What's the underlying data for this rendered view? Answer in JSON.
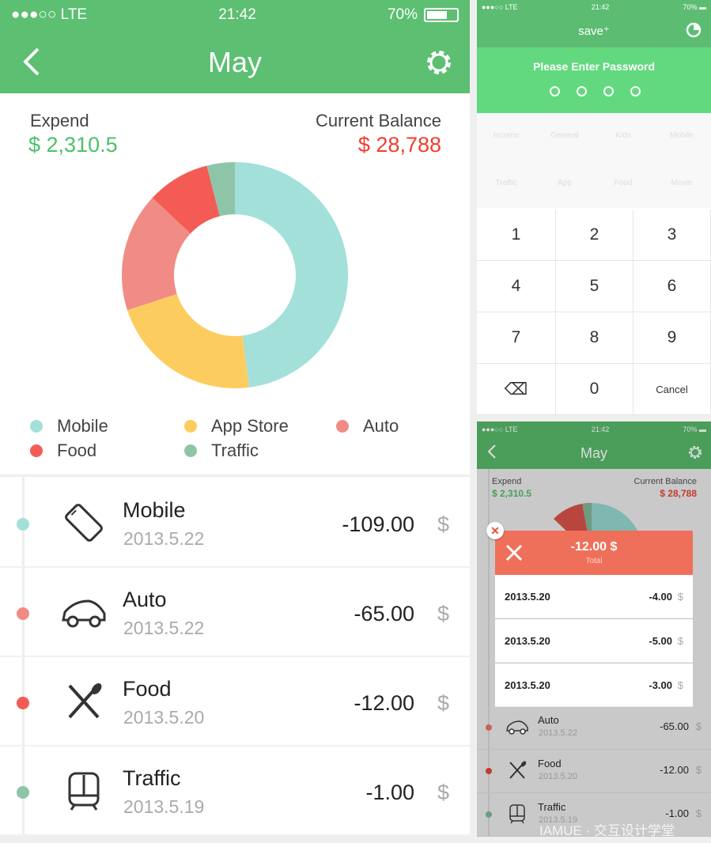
{
  "status": {
    "signal": "●●●○○",
    "carrier": "LTE",
    "time": "21:42",
    "battery": "70%"
  },
  "main": {
    "title": "May",
    "expend_label": "Expend",
    "expend_value": "$ 2,310.5",
    "balance_label": "Current Balance",
    "balance_value": "$ 28,788",
    "colors": {
      "header": "#5cbf72",
      "expend": "#4cc06a",
      "balance": "#f23d2e"
    },
    "donut": [
      {
        "name": "Mobile",
        "fraction": 0.48,
        "color": "#a3e0da"
      },
      {
        "name": "App Store",
        "fraction": 0.22,
        "color": "#fccd5e"
      },
      {
        "name": "Auto",
        "fraction": 0.17,
        "color": "#f08c85"
      },
      {
        "name": "Food",
        "fraction": 0.09,
        "color": "#f45b55"
      },
      {
        "name": "Traffic",
        "fraction": 0.04,
        "color": "#8ec5a8"
      }
    ],
    "legend": [
      "Mobile",
      "App Store",
      "Auto",
      "Food",
      "Traffic"
    ],
    "transactions": [
      {
        "name": "Mobile",
        "date": "2013.5.22",
        "amount": "-109.00",
        "currency": "$",
        "color": "#a3e0da",
        "icon": "phone-icon"
      },
      {
        "name": "Auto",
        "date": "2013.5.22",
        "amount": "-65.00",
        "currency": "$",
        "color": "#f08c85",
        "icon": "car-icon"
      },
      {
        "name": "Food",
        "date": "2013.5.20",
        "amount": "-12.00",
        "currency": "$",
        "color": "#f45b55",
        "icon": "fork-knife-icon"
      },
      {
        "name": "Traffic",
        "date": "2013.5.19",
        "amount": "-1.00",
        "currency": "$",
        "color": "#8ec5a8",
        "icon": "train-icon"
      }
    ]
  },
  "lock": {
    "app_title": "save⁺",
    "prompt": "Please Enter Password",
    "categories": [
      "Income",
      "General",
      "Kids",
      "Mobile",
      "Traffic",
      "App",
      "Food",
      "Movie"
    ],
    "keys": [
      "1",
      "2",
      "3",
      "4",
      "5",
      "6",
      "7",
      "8",
      "9",
      "⌫",
      "0",
      "Cancel"
    ]
  },
  "detail": {
    "total": "-12.00 $",
    "total_label": "Total",
    "rows": [
      {
        "date": "2013.5.20",
        "amount": "-4.00",
        "currency": "$"
      },
      {
        "date": "2013.5.20",
        "amount": "-5.00",
        "currency": "$"
      },
      {
        "date": "2013.5.20",
        "amount": "-3.00",
        "currency": "$"
      }
    ],
    "background_rows": [
      {
        "name": "Auto",
        "date": "2013.5.22",
        "amount": "-65.00",
        "currency": "$"
      },
      {
        "name": "Food",
        "date": "2013.5.20",
        "amount": "-12.00",
        "currency": "$"
      },
      {
        "name": "Traffic",
        "date": "2013.5.19",
        "amount": "-1.00",
        "currency": "$"
      }
    ],
    "watermark": "IAMUE · 交互设计学堂"
  }
}
